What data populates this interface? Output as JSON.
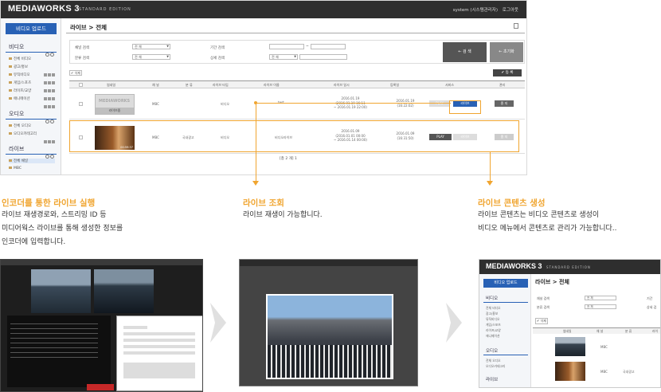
{
  "app": {
    "logo": "MEDIAWORKS 3",
    "logo_sub": "STANDARD EDITION",
    "user": "system (시스템관리자)",
    "logout": "로그아웃",
    "upload_button": "비디오 업로드",
    "sections": {
      "video": "비디오",
      "audio": "오디오",
      "live": "라이브"
    },
    "video_items": [
      "전체 비디오",
      "광고/홍보",
      "뮤직비디오",
      "게임/스포츠",
      "라이프/교양",
      "애니메이션"
    ],
    "audio_items": [
      "전체 오디오",
      "오디오카테고리"
    ],
    "live_items": [
      "전체 채널",
      "MBC"
    ],
    "breadcrumb": "라이브 > 전체",
    "filter": {
      "channel_label": "채널 검색",
      "channel_value": "전 체",
      "period_label": "기간 검색",
      "period_sep": "~",
      "category_label": "분류 검색",
      "category_value": "전 체",
      "detail_label": "상세 검색",
      "detail_value": "전 체",
      "search_button": "← 검 색",
      "reset_button": "← 초기화"
    },
    "delete_button": "✔ 삭제",
    "register_button": "✔ 등 록",
    "columns": [
      "썸네일",
      "채 널",
      "분 류",
      "라이브 타입",
      "라이브 이름",
      "라이브 일시",
      "등록일",
      "서비스",
      "관리"
    ],
    "rows": [
      {
        "thumb_logo": "MEDIAWORKS",
        "thumb_caption": "라이브중",
        "channel": "MBC",
        "category": "",
        "type": "비디오",
        "name": "test",
        "datetime_1": "2016.01.19",
        "datetime_2": "(2016.01.19 16:11",
        "datetime_3": "~ 2016.01.19 22:00)",
        "reg_1": "2016.01.19",
        "reg_2": "(16:22:02)",
        "service_btn1": "PLAY",
        "service_btn2": "라이브",
        "manage": "종 지"
      },
      {
        "thumb_time": "00:59:37",
        "channel": "MBC",
        "category": "국내광고",
        "type": "비디오",
        "name": "비디오라이브",
        "datetime_1": "2016.01.09",
        "datetime_2": "(2016.01.01 00:00",
        "datetime_3": "~ 2016.01.14 00:00)",
        "reg_1": "2016.01.09",
        "reg_2": "(16:31:50)",
        "service_btn1": "PLAY",
        "service_btn2": "라이브",
        "manage": "종 지"
      }
    ],
    "paging": "[총 2 개]   1"
  },
  "captions": [
    {
      "title": "인코더를 통한 라이브 실행",
      "lines": [
        "라이브 재생경로와, 스트리밍 ID 등",
        "미디어웍스 라이브를 통해 생성한 정보를",
        "인코더에 입력합니다."
      ]
    },
    {
      "title": "라이브 조회",
      "lines": [
        "라이브 재생이 가능합니다."
      ]
    },
    {
      "title": "라이브 콘텐츠 생성",
      "lines": [
        "라이브  콘텐츠는  비디오 콘텐츠로 생성이",
        "비디오 메뉴에서 콘텐츠로 관리가 가능합니다.."
      ]
    }
  ],
  "mini": {
    "logo": "MEDIAWORKS 3",
    "logo_sub": "STANDARD EDITION",
    "upload_button": "비디오 업로드",
    "breadcrumb": "라이브 > 전체",
    "video": "비디오",
    "video_items": [
      "전체 비디오",
      "광고/홍보",
      "뮤직비디오",
      "게임/스포츠",
      "라이프/교양",
      "애니메이션"
    ],
    "audio": "오디오",
    "audio_items": [
      "전체 오디오",
      "오디오카테고리"
    ],
    "live": "라이브",
    "channel_label": "채널 검색",
    "channel_value": "전 체",
    "category_label": "분류 검색",
    "category_value": "전 체",
    "period_label": "기간",
    "detail_label": "상세 검",
    "delete_button": "✔ 삭제",
    "columns": [
      "썸네일",
      "채 널",
      "분 류",
      "라이"
    ],
    "row1_channel": "MBC",
    "row2_channel": "MBC",
    "row2_category": "국내광고"
  },
  "colors": {
    "accent": "#f0a530",
    "brand_blue": "#2861b5",
    "topbar": "#2e2e2e"
  }
}
